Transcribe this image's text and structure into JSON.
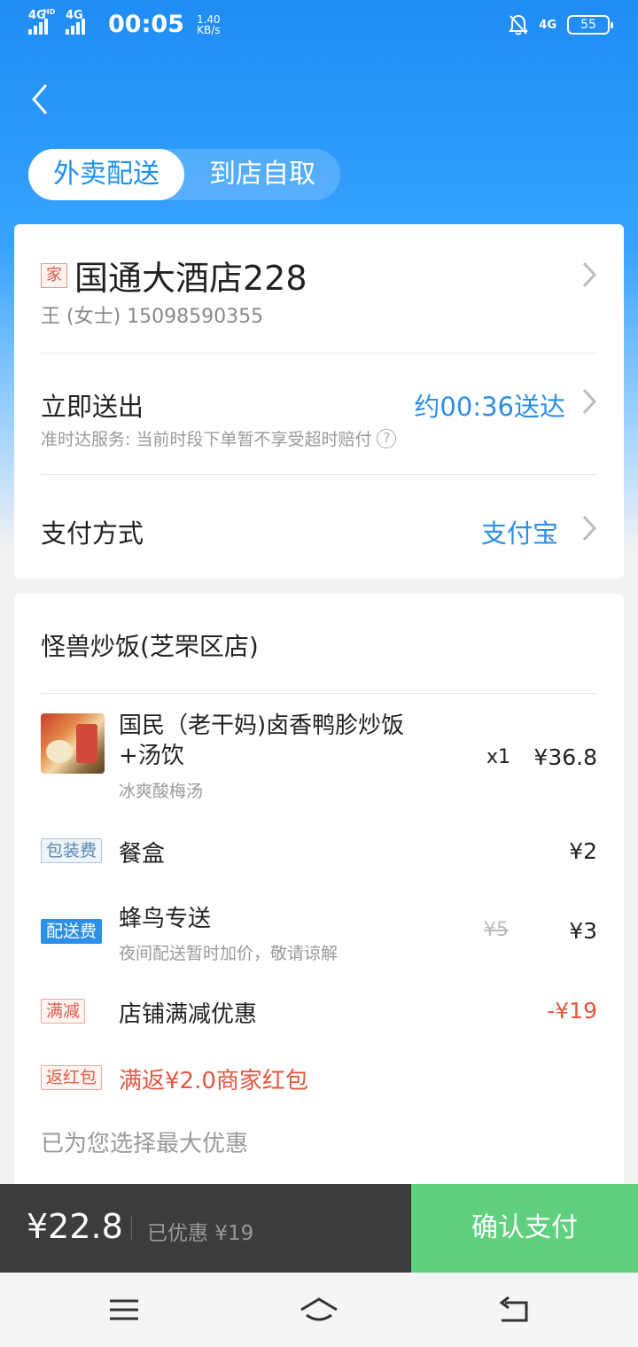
{
  "status_bar": {
    "net1": "4G",
    "net1_sup": "HD",
    "net2": "4G",
    "time": "00:05",
    "speed_value": "1.40",
    "speed_unit": "KB/s",
    "right_net": "4G",
    "battery": "55"
  },
  "tabs": [
    {
      "label": "外卖配送"
    },
    {
      "label": "到店自取"
    }
  ],
  "address": {
    "tag": "家",
    "title": "国通大酒店228",
    "contact": "王 (女士)  15098590355"
  },
  "delivery": {
    "title": "立即送出",
    "note": "准时达服务: 当前时段下单暂不享受超时赔付",
    "eta": "约00:36送达"
  },
  "payment": {
    "title": "支付方式",
    "method": "支付宝"
  },
  "order": {
    "shop": "怪兽炒饭(芝罘区店)",
    "item": {
      "name": "国民（老干妈)卤香鸭胗炒饭+汤饮",
      "spec": "冰爽酸梅汤",
      "qty": "x1",
      "price": "¥36.8"
    },
    "packaging": {
      "badge": "包装费",
      "label": "餐盒",
      "price": "¥2"
    },
    "delivery_fee": {
      "badge": "配送费",
      "label": "蜂鸟专送",
      "note": "夜间配送暂时加价，敬请谅解",
      "original": "¥5",
      "price": "¥3"
    },
    "discount": {
      "badge": "满减",
      "label": "店铺满减优惠",
      "amount": "-¥19"
    },
    "red_packet": {
      "badge": "返红包",
      "label": "满返¥2.0商家红包"
    },
    "hint": "已为您选择最大优惠"
  },
  "footer": {
    "total": "¥22.8",
    "saved": "已优惠 ¥19",
    "pay_button": "确认支付"
  },
  "colors": {
    "accent_blue": "#2c8ee6",
    "discount_red": "#e4573e",
    "pay_green": "#5ed07e"
  }
}
